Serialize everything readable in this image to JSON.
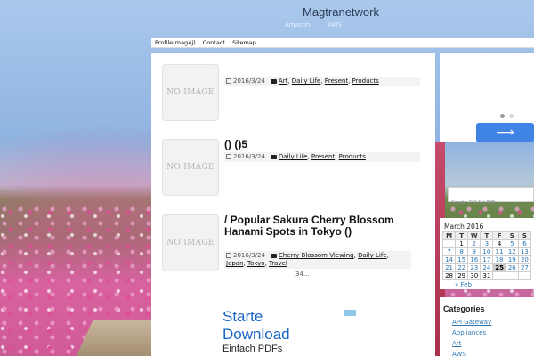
{
  "header": {
    "site_title": "Magtranetwork",
    "sub_nav": [
      "Amazon",
      "AWS"
    ]
  },
  "top_nav": [
    "Profile(mag4j)",
    "Contact",
    "Sitemap"
  ],
  "posts": [
    {
      "thumb_text": "NO IMAGE",
      "title": "",
      "date": "2016/3/24",
      "categories": [
        "Art",
        "Daily Life",
        "Present",
        "Products"
      ]
    },
    {
      "thumb_text": "NO IMAGE",
      "title": "() ()5",
      "date": "2016/3/24",
      "categories": [
        "Daily Life",
        "Present",
        "Products"
      ]
    },
    {
      "thumb_text": "NO IMAGE",
      "title": " / Popular Sakura Cherry Blossom Hanami Spots in Tokyo ()",
      "date": "2016/3/24",
      "categories": [
        "Cherry Blossom Viewing",
        "Daily Life",
        "Japan",
        "Tokyo",
        "Travel"
      ]
    }
  ],
  "pagination_text": "34...",
  "ad": {
    "line1": "Starte",
    "line2": "Download",
    "line3": "Einfach PDFs"
  },
  "sidebar": {
    "search_placeholder": "Google カスタム検索",
    "calendar": {
      "title": "March 2016",
      "weekdays": [
        "M",
        "T",
        "W",
        "T",
        "F",
        "S",
        "S"
      ],
      "weeks": [
        [
          "",
          "1",
          "2",
          "3",
          "4",
          "5",
          "6"
        ],
        [
          "7",
          "8",
          "9",
          "10",
          "11",
          "12",
          "13"
        ],
        [
          "14",
          "15",
          "16",
          "17",
          "18",
          "19",
          "20"
        ],
        [
          "21",
          "22",
          "23",
          "24",
          "25",
          "26",
          "27"
        ],
        [
          "28",
          "29",
          "30",
          "31",
          "",
          "",
          ""
        ]
      ],
      "linked_days": [
        "2",
        "3",
        "5",
        "6",
        "7",
        "8",
        "9",
        "10",
        "11",
        "12",
        "13",
        "14",
        "15",
        "16",
        "17",
        "18",
        "19",
        "20",
        "21",
        "22",
        "23",
        "24",
        "26",
        "27"
      ],
      "today": "25",
      "prev_link": "« Feb"
    },
    "categories_title": "Categories",
    "categories": [
      "API Gateway",
      "Appliances",
      "Art",
      "AWS"
    ]
  },
  "colors": {
    "accent_blue": "#3f84e5",
    "link_blue": "#2a76b5"
  }
}
